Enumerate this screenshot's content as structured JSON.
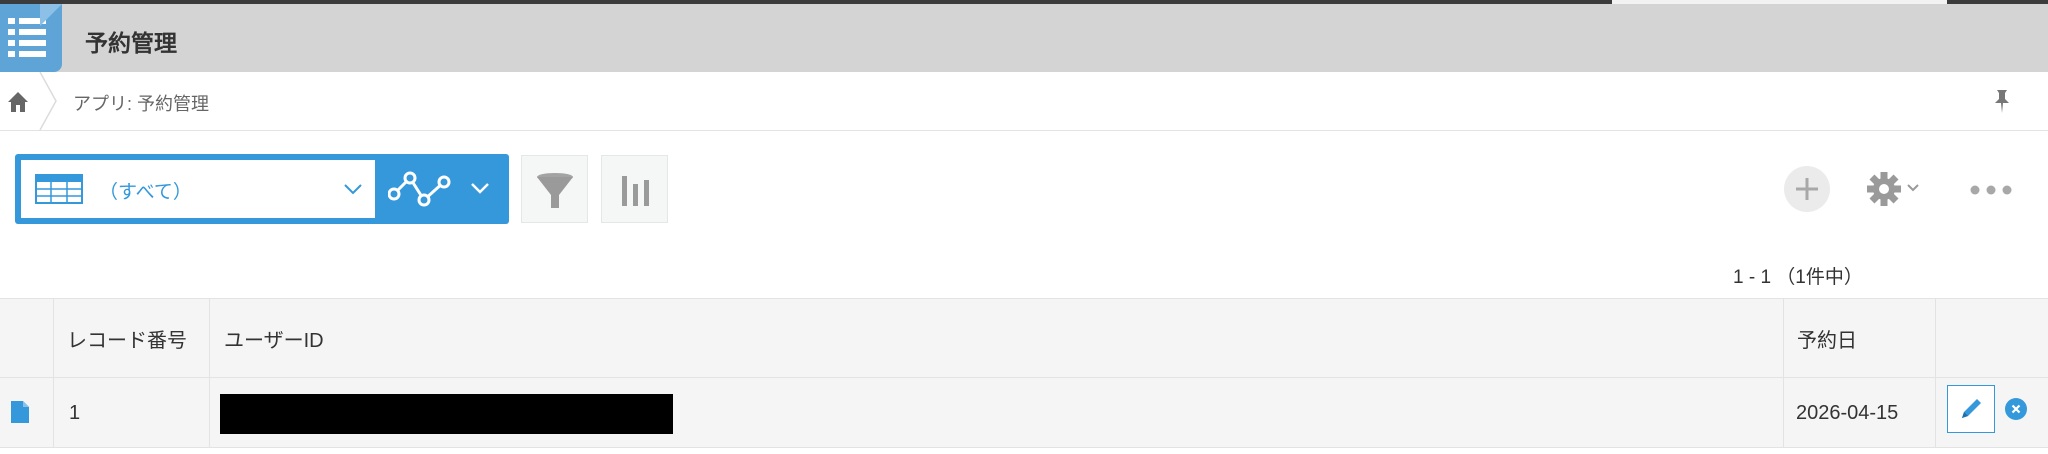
{
  "app": {
    "title": "予約管理"
  },
  "breadcrumb": {
    "text": "アプリ: 予約管理"
  },
  "toolbar": {
    "view_label": "（すべて）",
    "pager": "1 - 1 （1件中）"
  },
  "table": {
    "headers": [
      "レコード番号",
      "ユーザーID",
      "予約日"
    ],
    "rows": [
      {
        "record_no": "1",
        "user_id": "",
        "date": "2026-04-15"
      }
    ]
  },
  "colors": {
    "accent": "#3498db",
    "header_bg": "#d3d4d3",
    "app_icon": "#5fa4d6"
  },
  "icons": [
    "list-app-icon",
    "home-icon",
    "pin-icon",
    "table-view-icon",
    "chevron-down-icon",
    "graph-icon",
    "filter-icon",
    "bar-chart-icon",
    "plus-icon",
    "gear-icon",
    "more-icon",
    "document-icon",
    "pencil-icon",
    "close-icon"
  ]
}
